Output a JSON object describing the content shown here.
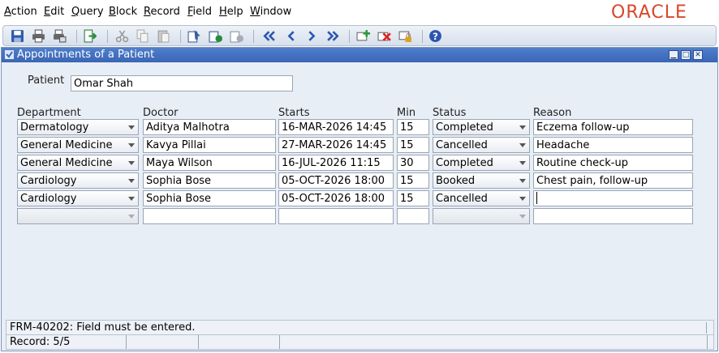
{
  "menubar": {
    "items": [
      {
        "accel": "A",
        "rest": "ction"
      },
      {
        "accel": "E",
        "rest": "dit"
      },
      {
        "accel": "Q",
        "rest": "uery"
      },
      {
        "accel": "B",
        "rest": "lock"
      },
      {
        "accel": "R",
        "rest": "ecord"
      },
      {
        "accel": "F",
        "rest": "ield"
      },
      {
        "accel": "H",
        "rest": "elp"
      },
      {
        "accel": "W",
        "rest": "indow"
      }
    ],
    "logo": "ORACLE"
  },
  "toolbar": {
    "icons": [
      "save-icon",
      "print-icon",
      "print-setup-icon",
      "exit-icon",
      "cut-icon",
      "copy-icon",
      "paste-icon",
      "enter-query-icon",
      "execute-query-icon",
      "cancel-query-icon",
      "first-record-icon",
      "previous-record-icon",
      "next-record-icon",
      "last-record-icon",
      "insert-record-icon",
      "delete-record-icon",
      "lock-record-icon",
      "help-icon"
    ]
  },
  "window": {
    "title": "Appointments of a Patient",
    "patient_label": "Patient",
    "patient_value": "Omar Shah",
    "columns": {
      "department": "Department",
      "doctor": "Doctor",
      "starts": "Starts",
      "min": "Min",
      "status": "Status",
      "reason": "Reason"
    },
    "rows": [
      {
        "department": "Dermatology",
        "doctor": "Aditya Malhotra",
        "starts": "16-MAR-2026 14:45",
        "min": "15",
        "status": "Completed",
        "reason": "Eczema follow-up"
      },
      {
        "department": "General Medicine",
        "doctor": "Kavya Pillai",
        "starts": "27-MAR-2026 14:45",
        "min": "15",
        "status": "Cancelled",
        "reason": "Headache"
      },
      {
        "department": "General Medicine",
        "doctor": "Maya Wilson",
        "starts": "16-JUL-2026 11:15",
        "min": "30",
        "status": "Completed",
        "reason": "Routine check-up"
      },
      {
        "department": "Cardiology",
        "doctor": "Sophia Bose",
        "starts": "05-OCT-2026 18:00",
        "min": "15",
        "status": "Booked",
        "reason": "Chest pain, follow-up"
      },
      {
        "department": "Cardiology",
        "doctor": "Sophia Bose",
        "starts": "05-OCT-2026 18:00",
        "min": "15",
        "status": "Cancelled",
        "reason": ""
      },
      {
        "department": "",
        "doctor": "",
        "starts": "",
        "min": "",
        "status": "",
        "reason": ""
      }
    ]
  },
  "status": {
    "message": "FRM-40202: Field must be entered.",
    "record": "Record: 5/5"
  },
  "colors": {
    "logo": "#d9472b",
    "titlebar": "#3f6cbc",
    "window_bg": "#e8eef6"
  }
}
